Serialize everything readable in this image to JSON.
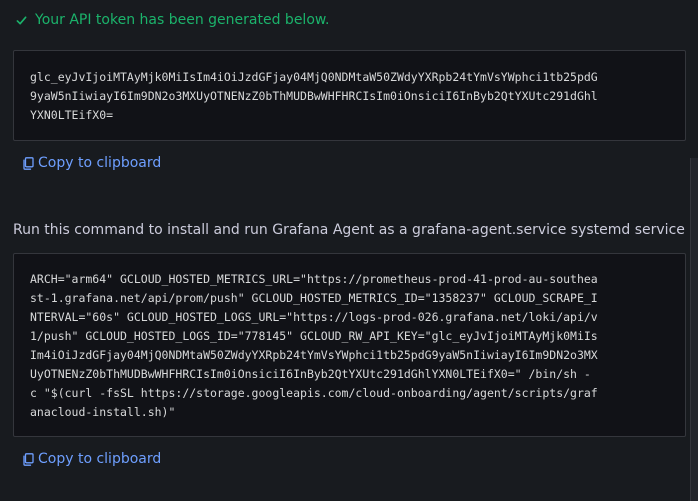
{
  "success_message": "Your API token has been generated below.",
  "token": {
    "lines": [
      "glc_eyJvIjoiMTAyMjk0MiIsIm4iOiJzdGFjay04MjQ0NDMtaW50ZWdyYXRpb24tYmVsYWphci1tb25pdG",
      "9yaW5nIiwiayI6Im9DN2o3MXUyOTNENzZ0bThMUDBwWHFHRCIsIm0iOnsiciI6InByb2QtYXUtc291dGhl",
      "YXN0LTEifX0="
    ]
  },
  "copy_label": "Copy to clipboard",
  "instruction": "Run this command to install and run Grafana Agent as a grafana-agent.service systemd service",
  "command": {
    "lines": [
      "ARCH=\"arm64\" GCLOUD_HOSTED_METRICS_URL=\"https://prometheus-prod-41-prod-au-southea",
      "st-1.grafana.net/api/prom/push\" GCLOUD_HOSTED_METRICS_ID=\"1358237\" GCLOUD_SCRAPE_I",
      "NTERVAL=\"60s\" GCLOUD_HOSTED_LOGS_URL=\"https://logs-prod-026.grafana.net/loki/api/v",
      "1/push\" GCLOUD_HOSTED_LOGS_ID=\"778145\" GCLOUD_RW_API_KEY=\"glc_eyJvIjoiMTAyMjk0MiIs",
      "Im4iOiJzdGFjay04MjQ0NDMtaW50ZWdyYXRpb24tYmVsYWphci1tb25pdG9yaW5nIiwiayI6Im9DN2o3MX",
      "UyOTNENzZ0bThMUDBwWHFHRCIsIm0iOnsiciI6InByb2QtYXUtc291dGhlYXN0LTEifX0=\" /bin/sh -",
      "c \"$(curl -fsSL https://storage.googleapis.com/cloud-onboarding/agent/scripts/graf",
      "anacloud-install.sh)\""
    ]
  },
  "colors": {
    "background": "#181b1f",
    "success": "#1bb36b",
    "link": "#6e9fff",
    "code_bg": "#111217",
    "border": "#34363c"
  },
  "icons": {
    "success": "check-icon",
    "copy": "copy-icon"
  }
}
